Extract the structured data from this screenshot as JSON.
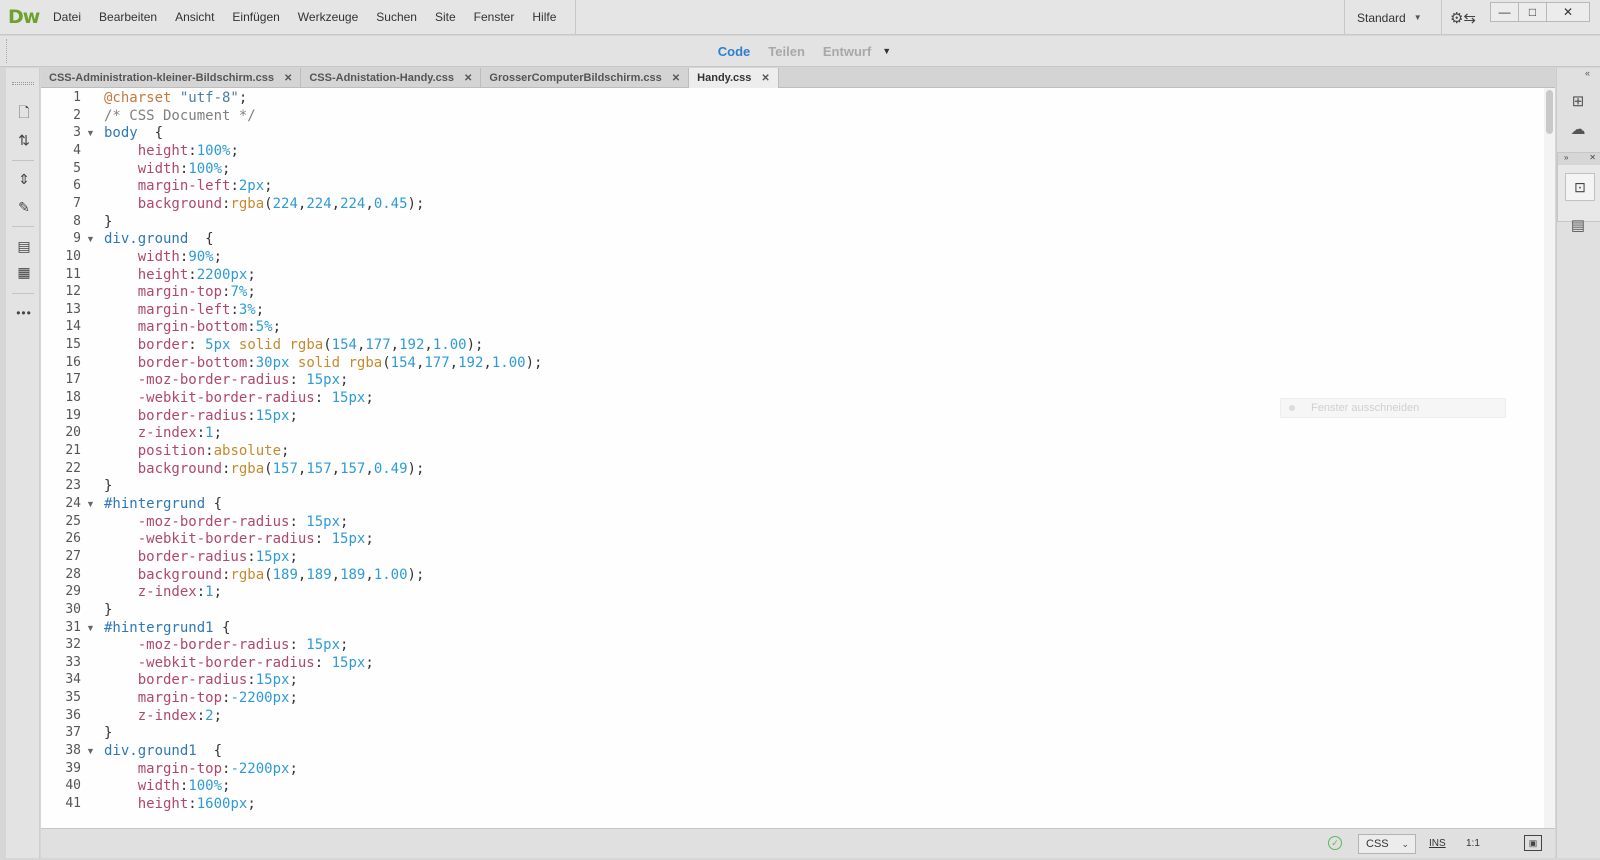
{
  "app": {
    "logo": "Dw",
    "menus": [
      "Datei",
      "Bearbeiten",
      "Ansicht",
      "Einfügen",
      "Werkzeuge",
      "Suchen",
      "Site",
      "Fenster",
      "Hilfe"
    ],
    "layout": "Standard",
    "window_controls": {
      "minimize": "—",
      "maximize": "□",
      "close": "✕"
    }
  },
  "view_switcher": {
    "code": "Code",
    "split": "Teilen",
    "design": "Entwurf"
  },
  "tabs": [
    {
      "label": "CSS-Administration-kleiner-Bildschirm.css",
      "active": false
    },
    {
      "label": "CSS-Adnistation-Handy.css",
      "active": false
    },
    {
      "label": "GrosserComputerBildschirm.css",
      "active": false
    },
    {
      "label": "Handy.css",
      "active": true
    }
  ],
  "editor": {
    "lines": [
      {
        "n": "1",
        "fold": "",
        "tokens": [
          [
            "at",
            "@charset "
          ],
          [
            "str",
            "\"utf-8\""
          ],
          [
            "p",
            ";"
          ]
        ]
      },
      {
        "n": "2",
        "fold": "",
        "tokens": [
          [
            "cmt",
            "/* CSS Document */"
          ]
        ]
      },
      {
        "n": "3",
        "fold": "▼",
        "tokens": [
          [
            "sel",
            "body"
          ],
          [
            "p",
            "  {"
          ]
        ]
      },
      {
        "n": "4",
        "fold": "",
        "tokens": [
          [
            "p",
            "    "
          ],
          [
            "prop",
            "height"
          ],
          [
            "p",
            ":"
          ],
          [
            "val",
            "100%"
          ],
          [
            "p",
            ";"
          ]
        ]
      },
      {
        "n": "5",
        "fold": "",
        "tokens": [
          [
            "p",
            "    "
          ],
          [
            "prop",
            "width"
          ],
          [
            "p",
            ":"
          ],
          [
            "val",
            "100%"
          ],
          [
            "p",
            ";"
          ]
        ]
      },
      {
        "n": "6",
        "fold": "",
        "tokens": [
          [
            "p",
            "    "
          ],
          [
            "prop",
            "margin-left"
          ],
          [
            "p",
            ":"
          ],
          [
            "val",
            "2px"
          ],
          [
            "p",
            ";"
          ]
        ]
      },
      {
        "n": "7",
        "fold": "",
        "tokens": [
          [
            "p",
            "    "
          ],
          [
            "prop",
            "background"
          ],
          [
            "p",
            ":"
          ],
          [
            "kw",
            "rgba"
          ],
          [
            "p",
            "("
          ],
          [
            "val",
            "224"
          ],
          [
            "p",
            ","
          ],
          [
            "val",
            "224"
          ],
          [
            "p",
            ","
          ],
          [
            "val",
            "224"
          ],
          [
            "p",
            ","
          ],
          [
            "val",
            "0.45"
          ],
          [
            "p",
            ");"
          ]
        ]
      },
      {
        "n": "8",
        "fold": "",
        "tokens": [
          [
            "p",
            "}"
          ]
        ]
      },
      {
        "n": "9",
        "fold": "▼",
        "tokens": [
          [
            "sel",
            "div.ground"
          ],
          [
            "p",
            "  {"
          ]
        ]
      },
      {
        "n": "10",
        "fold": "",
        "tokens": [
          [
            "p",
            "    "
          ],
          [
            "prop",
            "width"
          ],
          [
            "p",
            ":"
          ],
          [
            "val",
            "90%"
          ],
          [
            "p",
            ";"
          ]
        ]
      },
      {
        "n": "11",
        "fold": "",
        "tokens": [
          [
            "p",
            "    "
          ],
          [
            "prop",
            "height"
          ],
          [
            "p",
            ":"
          ],
          [
            "val",
            "2200px"
          ],
          [
            "p",
            ";"
          ]
        ]
      },
      {
        "n": "12",
        "fold": "",
        "tokens": [
          [
            "p",
            "    "
          ],
          [
            "prop",
            "margin-top"
          ],
          [
            "p",
            ":"
          ],
          [
            "val",
            "7%"
          ],
          [
            "p",
            ";"
          ]
        ]
      },
      {
        "n": "13",
        "fold": "",
        "tokens": [
          [
            "p",
            "    "
          ],
          [
            "prop",
            "margin-left"
          ],
          [
            "p",
            ":"
          ],
          [
            "val",
            "3%"
          ],
          [
            "p",
            ";"
          ]
        ]
      },
      {
        "n": "14",
        "fold": "",
        "tokens": [
          [
            "p",
            "    "
          ],
          [
            "prop",
            "margin-bottom"
          ],
          [
            "p",
            ":"
          ],
          [
            "val",
            "5%"
          ],
          [
            "p",
            ";"
          ]
        ]
      },
      {
        "n": "15",
        "fold": "",
        "tokens": [
          [
            "p",
            "    "
          ],
          [
            "prop",
            "border"
          ],
          [
            "p",
            ": "
          ],
          [
            "val",
            "5px"
          ],
          [
            "p",
            " "
          ],
          [
            "kw",
            "solid"
          ],
          [
            "p",
            " "
          ],
          [
            "kw",
            "rgba"
          ],
          [
            "p",
            "("
          ],
          [
            "val",
            "154"
          ],
          [
            "p",
            ","
          ],
          [
            "val",
            "177"
          ],
          [
            "p",
            ","
          ],
          [
            "val",
            "192"
          ],
          [
            "p",
            ","
          ],
          [
            "val",
            "1.00"
          ],
          [
            "p",
            ");"
          ]
        ]
      },
      {
        "n": "16",
        "fold": "",
        "tokens": [
          [
            "p",
            "    "
          ],
          [
            "prop",
            "border-bottom"
          ],
          [
            "p",
            ":"
          ],
          [
            "val",
            "30px"
          ],
          [
            "p",
            " "
          ],
          [
            "kw",
            "solid"
          ],
          [
            "p",
            " "
          ],
          [
            "kw",
            "rgba"
          ],
          [
            "p",
            "("
          ],
          [
            "val",
            "154"
          ],
          [
            "p",
            ","
          ],
          [
            "val",
            "177"
          ],
          [
            "p",
            ","
          ],
          [
            "val",
            "192"
          ],
          [
            "p",
            ","
          ],
          [
            "val",
            "1.00"
          ],
          [
            "p",
            ");"
          ]
        ]
      },
      {
        "n": "17",
        "fold": "",
        "tokens": [
          [
            "p",
            "    "
          ],
          [
            "prop",
            "-moz-border-radius"
          ],
          [
            "p",
            ": "
          ],
          [
            "val",
            "15px"
          ],
          [
            "p",
            ";"
          ]
        ]
      },
      {
        "n": "18",
        "fold": "",
        "tokens": [
          [
            "p",
            "    "
          ],
          [
            "prop",
            "-webkit-border-radius"
          ],
          [
            "p",
            ": "
          ],
          [
            "val",
            "15px"
          ],
          [
            "p",
            ";"
          ]
        ]
      },
      {
        "n": "19",
        "fold": "",
        "tokens": [
          [
            "p",
            "    "
          ],
          [
            "prop",
            "border-radius"
          ],
          [
            "p",
            ":"
          ],
          [
            "val",
            "15px"
          ],
          [
            "p",
            ";"
          ]
        ]
      },
      {
        "n": "20",
        "fold": "",
        "tokens": [
          [
            "p",
            "    "
          ],
          [
            "prop",
            "z-index"
          ],
          [
            "p",
            ":"
          ],
          [
            "val",
            "1"
          ],
          [
            "p",
            ";"
          ]
        ]
      },
      {
        "n": "21",
        "fold": "",
        "tokens": [
          [
            "p",
            "    "
          ],
          [
            "prop",
            "position"
          ],
          [
            "p",
            ":"
          ],
          [
            "kw",
            "absolute"
          ],
          [
            "p",
            ";"
          ]
        ]
      },
      {
        "n": "22",
        "fold": "",
        "tokens": [
          [
            "p",
            "    "
          ],
          [
            "prop",
            "background"
          ],
          [
            "p",
            ":"
          ],
          [
            "kw",
            "rgba"
          ],
          [
            "p",
            "("
          ],
          [
            "val",
            "157"
          ],
          [
            "p",
            ","
          ],
          [
            "val",
            "157"
          ],
          [
            "p",
            ","
          ],
          [
            "val",
            "157"
          ],
          [
            "p",
            ","
          ],
          [
            "val",
            "0.49"
          ],
          [
            "p",
            ");"
          ]
        ]
      },
      {
        "n": "23",
        "fold": "",
        "tokens": [
          [
            "p",
            "}"
          ]
        ]
      },
      {
        "n": "24",
        "fold": "▼",
        "tokens": [
          [
            "sel",
            "#hintergrund"
          ],
          [
            "p",
            " {"
          ]
        ]
      },
      {
        "n": "25",
        "fold": "",
        "tokens": [
          [
            "p",
            "    "
          ],
          [
            "prop",
            "-moz-border-radius"
          ],
          [
            "p",
            ": "
          ],
          [
            "val",
            "15px"
          ],
          [
            "p",
            ";"
          ]
        ]
      },
      {
        "n": "26",
        "fold": "",
        "tokens": [
          [
            "p",
            "    "
          ],
          [
            "prop",
            "-webkit-border-radius"
          ],
          [
            "p",
            ": "
          ],
          [
            "val",
            "15px"
          ],
          [
            "p",
            ";"
          ]
        ]
      },
      {
        "n": "27",
        "fold": "",
        "tokens": [
          [
            "p",
            "    "
          ],
          [
            "prop",
            "border-radius"
          ],
          [
            "p",
            ":"
          ],
          [
            "val",
            "15px"
          ],
          [
            "p",
            ";"
          ]
        ]
      },
      {
        "n": "28",
        "fold": "",
        "tokens": [
          [
            "p",
            "    "
          ],
          [
            "prop",
            "background"
          ],
          [
            "p",
            ":"
          ],
          [
            "kw",
            "rgba"
          ],
          [
            "p",
            "("
          ],
          [
            "val",
            "189"
          ],
          [
            "p",
            ","
          ],
          [
            "val",
            "189"
          ],
          [
            "p",
            ","
          ],
          [
            "val",
            "189"
          ],
          [
            "p",
            ","
          ],
          [
            "val",
            "1.00"
          ],
          [
            "p",
            ");"
          ]
        ]
      },
      {
        "n": "29",
        "fold": "",
        "tokens": [
          [
            "p",
            "    "
          ],
          [
            "prop",
            "z-index"
          ],
          [
            "p",
            ":"
          ],
          [
            "val",
            "1"
          ],
          [
            "p",
            ";"
          ]
        ]
      },
      {
        "n": "30",
        "fold": "",
        "tokens": [
          [
            "p",
            "}"
          ]
        ]
      },
      {
        "n": "31",
        "fold": "▼",
        "tokens": [
          [
            "sel",
            "#hintergrund1"
          ],
          [
            "p",
            " {"
          ]
        ]
      },
      {
        "n": "32",
        "fold": "",
        "tokens": [
          [
            "p",
            "    "
          ],
          [
            "prop",
            "-moz-border-radius"
          ],
          [
            "p",
            ": "
          ],
          [
            "val",
            "15px"
          ],
          [
            "p",
            ";"
          ]
        ]
      },
      {
        "n": "33",
        "fold": "",
        "tokens": [
          [
            "p",
            "    "
          ],
          [
            "prop",
            "-webkit-border-radius"
          ],
          [
            "p",
            ": "
          ],
          [
            "val",
            "15px"
          ],
          [
            "p",
            ";"
          ]
        ]
      },
      {
        "n": "34",
        "fold": "",
        "tokens": [
          [
            "p",
            "    "
          ],
          [
            "prop",
            "border-radius"
          ],
          [
            "p",
            ":"
          ],
          [
            "val",
            "15px"
          ],
          [
            "p",
            ";"
          ]
        ]
      },
      {
        "n": "35",
        "fold": "",
        "tokens": [
          [
            "p",
            "    "
          ],
          [
            "prop",
            "margin-top"
          ],
          [
            "p",
            ":"
          ],
          [
            "val",
            "-2200px"
          ],
          [
            "p",
            ";"
          ]
        ]
      },
      {
        "n": "36",
        "fold": "",
        "tokens": [
          [
            "p",
            "    "
          ],
          [
            "prop",
            "z-index"
          ],
          [
            "p",
            ":"
          ],
          [
            "val",
            "2"
          ],
          [
            "p",
            ";"
          ]
        ]
      },
      {
        "n": "37",
        "fold": "",
        "tokens": [
          [
            "p",
            "}"
          ]
        ]
      },
      {
        "n": "38",
        "fold": "▼",
        "tokens": [
          [
            "sel",
            "div.ground1"
          ],
          [
            "p",
            "  {"
          ]
        ]
      },
      {
        "n": "39",
        "fold": "",
        "tokens": [
          [
            "p",
            "    "
          ],
          [
            "prop",
            "margin-top"
          ],
          [
            "p",
            ":"
          ],
          [
            "val",
            "-2200px"
          ],
          [
            "p",
            ";"
          ]
        ]
      },
      {
        "n": "40",
        "fold": "",
        "tokens": [
          [
            "p",
            "    "
          ],
          [
            "prop",
            "width"
          ],
          [
            "p",
            ":"
          ],
          [
            "val",
            "100%"
          ],
          [
            "p",
            ";"
          ]
        ]
      },
      {
        "n": "41",
        "fold": "",
        "tokens": [
          [
            "p",
            "    "
          ],
          [
            "prop",
            "height"
          ],
          [
            "p",
            ":"
          ],
          [
            "val",
            "1600px"
          ],
          [
            "p",
            ";"
          ]
        ]
      }
    ],
    "ghost_label": "Fenster ausschneiden"
  },
  "statusbar": {
    "language": "CSS",
    "insert_mode": "INS",
    "cursor_position": "1:1"
  },
  "icons": {
    "left_toolbar": [
      "new-document-icon",
      "sort-icon",
      "expand-collapse-icon",
      "format-icon",
      "comment-icon",
      "snippet-icon",
      "more-icon"
    ],
    "right_panel": [
      "site-structure-icon",
      "cc-libraries-icon",
      "insert-panel-icon",
      "dom-panel-icon"
    ]
  },
  "colors": {
    "logo": "#6ea12f",
    "active_view": "#2d7fd0",
    "selector": "#2e78b8",
    "property": "#b0486d",
    "value": "#2e9bd6",
    "keyword": "#c58a2d"
  }
}
